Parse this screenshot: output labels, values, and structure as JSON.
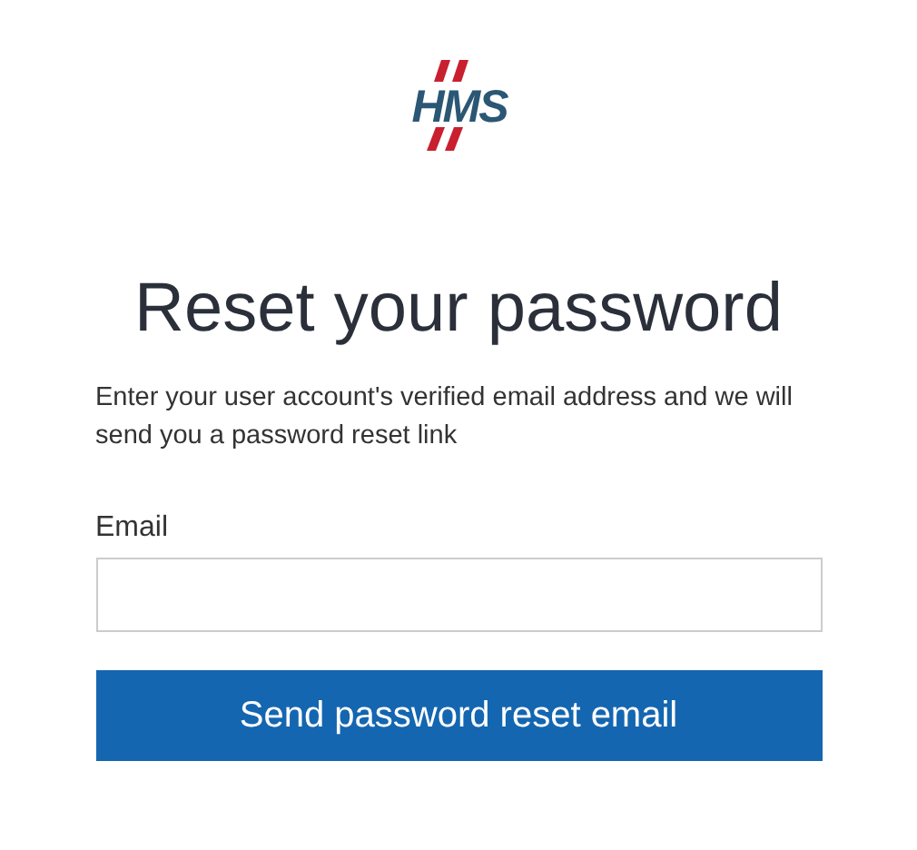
{
  "logo": {
    "text": "HMS"
  },
  "title": "Reset your password",
  "description": "Enter your user account's verified email address and we will send you a password reset link",
  "email_field": {
    "label": "Email"
  },
  "submit_button": {
    "label": "Send password reset email"
  }
}
